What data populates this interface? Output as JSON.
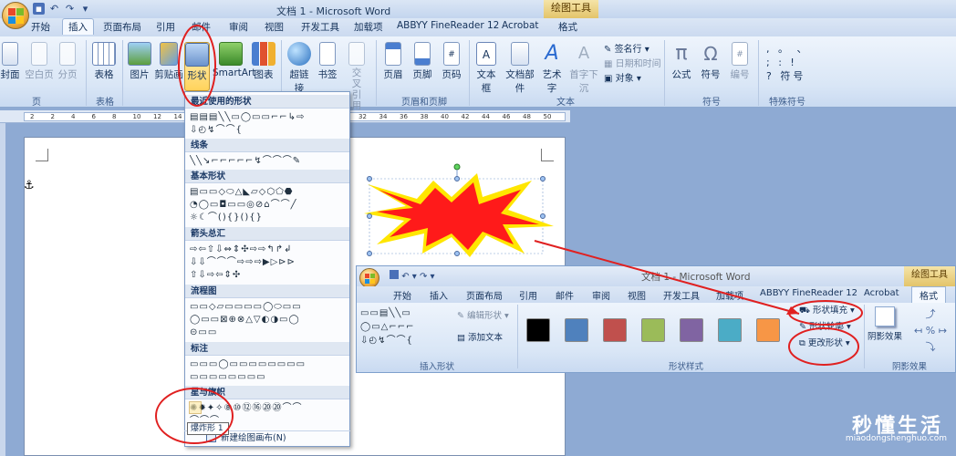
{
  "window": {
    "title": "文档 1 - Microsoft Word",
    "context_tab_group": "绘图工具"
  },
  "quick_access": [
    "save-icon",
    "undo-icon",
    "redo-icon",
    "customize-icon"
  ],
  "tabs": [
    "开始",
    "插入",
    "页面布局",
    "引用",
    "邮件",
    "审阅",
    "视图",
    "开发工具",
    "加载项",
    "ABBYY FineReader 12",
    "Acrobat",
    "格式"
  ],
  "active_tab": "插入",
  "ribbon": {
    "buttons": [
      "封面",
      "空白页",
      "分页",
      "表格",
      "图片",
      "剪贴画",
      "形状",
      "SmartArt",
      "图表",
      "超链接",
      "书签",
      "交叉引用",
      "页眉",
      "页脚",
      "页码",
      "文本框",
      "文档部件",
      "艺术字",
      "首字下沉",
      "公式",
      "符号",
      "编号"
    ],
    "groups": [
      "页",
      "表格",
      "插图",
      "链接",
      "页眉和页脚",
      "文本",
      "符号",
      "特殊符号"
    ],
    "text_small": [
      "签名行",
      "日期和时间",
      "对象"
    ],
    "special_symbols": ", 。 、 ; : ! ? 符号"
  },
  "ruler": [
    "2",
    "2",
    "4",
    "6",
    "8",
    "10",
    "12",
    "14",
    "16",
    "18",
    "20",
    "22",
    "24",
    "26",
    "28",
    "30",
    "32",
    "34",
    "36",
    "38",
    "40",
    "42",
    "44",
    "46",
    "48",
    "50"
  ],
  "shapes_menu": {
    "sections": [
      "最近使用的形状",
      "线条",
      "基本形状",
      "箭头总汇",
      "流程图",
      "标注",
      "星与旗帜"
    ],
    "rows": {
      "recent": [
        "▤▤▤╲╲▭◯▭▭⌐⌐↳⇨",
        "⇩◴↯⌒⌒{"
      ],
      "lines": [
        "╲╲↘⌐⌐⌐⌐⌐↯⌒⌒⌒✎"
      ],
      "basic": [
        "▤▭▭◇⬭△◣▱◇⬡⬠⬣",
        "◔◯▭◘▭▭◎⊘⌂⌒⌒╱",
        "☼☾⌒(){}(){}",
        ""
      ],
      "arrows": [
        "⇨⇦⇧⇩⇔⇕✣⇨⇨↰↱↲",
        "⇩⇩⌒⌒⌒⇨⇨⇨▶▷⊳⊳",
        "⇧⇩⇨⇦⇕✣"
      ],
      "flowchart": [
        "▭▭◇▱▭▭▭▭◯⬭▭▭",
        "◯▭▭⊠⊕⊗△▽◐◑▭◯",
        "⊝▭▭"
      ],
      "callouts": [
        "▭▭▭◯▭▭▭▭▭▭▭▭",
        "▭▭▭▭▭▭▭▭"
      ],
      "stars": [
        "✺✹✦✧⑧⑩⑫⑯⑳⑳⌒⌒",
        "⌒⌒⌒"
      ]
    },
    "tooltip": "爆炸形 1",
    "new_canvas": "新建绘图画布(N)"
  },
  "inset": {
    "title": "文档 1 - Microsoft Word",
    "context_tab_group": "绘图工具",
    "tabs": [
      "开始",
      "插入",
      "页面布局",
      "引用",
      "邮件",
      "审阅",
      "视图",
      "开发工具",
      "加载项",
      "ABBYY FineReader 12",
      "Acrobat",
      "格式"
    ],
    "edit_shape": "编辑形状",
    "add_text": "添加文本",
    "group_insert_shape": "插入形状",
    "group_shape_styles": "形状样式",
    "group_shadow": "阴影效果",
    "shadow_button": "阴影效果",
    "fill": "形状填充",
    "outline": "形状轮廓",
    "change": "更改形状",
    "swatch_colors": [
      "#000000",
      "#4f81bd",
      "#c0504d",
      "#9bbb59",
      "#8064a2",
      "#4bacc6",
      "#f79646"
    ]
  },
  "colors": {
    "accent_annotation": "#e02020",
    "star_fill": "#ff1a1a",
    "star_outline": "#ffe600"
  },
  "watermark": {
    "brand": "秒懂生活",
    "url": "miaodongshenghuo.com"
  }
}
